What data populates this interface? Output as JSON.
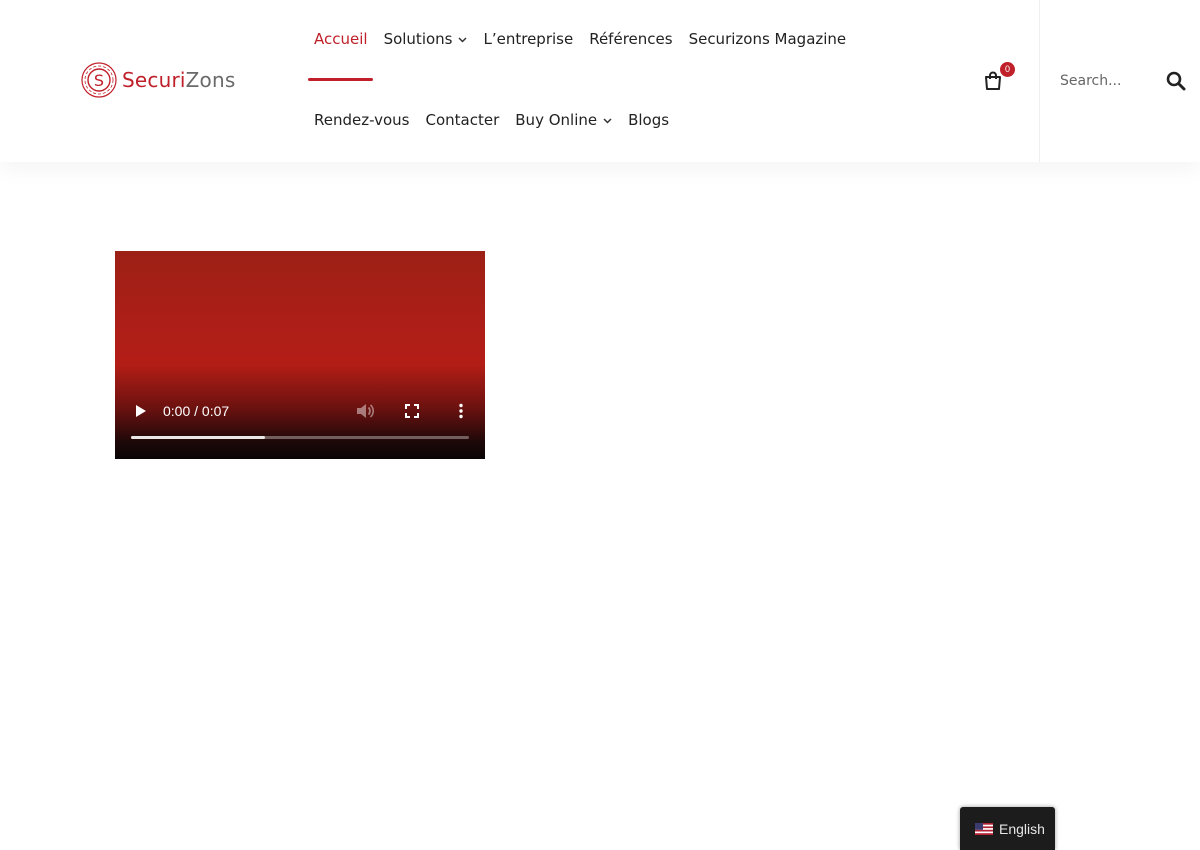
{
  "header": {
    "logo": {
      "part1": "Securi",
      "part2": "Zons"
    },
    "nav_row1": [
      {
        "label": "Accueil",
        "active": true,
        "dropdown": false
      },
      {
        "label": "Solutions",
        "active": false,
        "dropdown": true
      },
      {
        "label": "L’entreprise",
        "active": false,
        "dropdown": false
      },
      {
        "label": "Références",
        "active": false,
        "dropdown": false
      },
      {
        "label": "Securizons Magazine",
        "active": false,
        "dropdown": false
      }
    ],
    "nav_row2": [
      {
        "label": "Rendez-vous",
        "active": false,
        "dropdown": false
      },
      {
        "label": "Contacter",
        "active": false,
        "dropdown": false
      },
      {
        "label": "Buy Online",
        "active": false,
        "dropdown": true
      },
      {
        "label": "Blogs",
        "active": false,
        "dropdown": false
      }
    ],
    "cart": {
      "icon": "shopping-bag-icon",
      "count": "0"
    },
    "search": {
      "placeholder": "Search...",
      "icon": "search-icon"
    }
  },
  "video": {
    "time": "0:00 / 0:07",
    "progress_fraction": 0.395,
    "controls": [
      "play-icon",
      "volume-icon",
      "fullscreen-icon",
      "more-options-icon"
    ]
  },
  "language_switcher": {
    "label": "English",
    "icon": "us-flag-icon"
  },
  "colors": {
    "accent": "#c0202a",
    "text": "#222222",
    "switcher_bg": "#1c1c1c"
  }
}
